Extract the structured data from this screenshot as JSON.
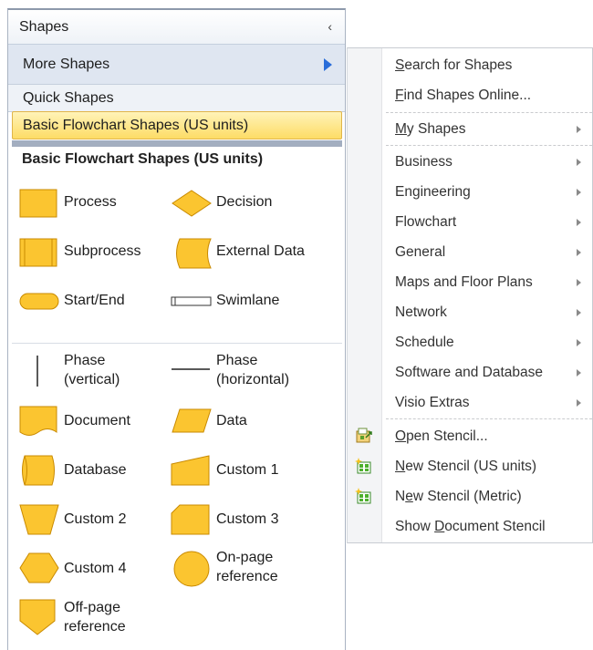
{
  "panel": {
    "title": "Shapes",
    "collapse_glyph": "‹",
    "more_shapes": "More Shapes",
    "quick_shapes": "Quick Shapes",
    "selected_stencil": "Basic Flowchart Shapes (US units)",
    "stencil_title": "Basic Flowchart Shapes (US units)",
    "shapes": [
      {
        "label": "Process",
        "icon": "process-icon"
      },
      {
        "label": "Decision",
        "icon": "decision-icon"
      },
      {
        "label": "Subprocess",
        "icon": "subprocess-icon"
      },
      {
        "label": "External Data",
        "icon": "external-data-icon"
      },
      {
        "label": "Start/End",
        "icon": "start-end-icon"
      },
      {
        "label": "Swimlane",
        "icon": "swimlane-icon"
      },
      {
        "label": "Phase\n(vertical)",
        "icon": "phase-vertical-icon"
      },
      {
        "label": "Phase\n(horizontal)",
        "icon": "phase-horizontal-icon"
      },
      {
        "label": "Document",
        "icon": "document-icon"
      },
      {
        "label": "Data",
        "icon": "data-icon"
      },
      {
        "label": "Database",
        "icon": "database-icon"
      },
      {
        "label": "Custom 1",
        "icon": "custom-1-icon"
      },
      {
        "label": "Custom 2",
        "icon": "custom-2-icon"
      },
      {
        "label": "Custom 3",
        "icon": "custom-3-icon"
      },
      {
        "label": "Custom 4",
        "icon": "custom-4-icon"
      },
      {
        "label": "On-page\nreference",
        "icon": "on-page-reference-icon"
      },
      {
        "label": "Off-page\nreference",
        "icon": "off-page-reference-icon"
      }
    ]
  },
  "menu": {
    "search_for_shapes": {
      "pre": "",
      "key": "S",
      "post": "earch for Shapes"
    },
    "find_shapes_online": {
      "pre": "",
      "key": "F",
      "post": "ind Shapes Online..."
    },
    "my_shapes": {
      "pre": "",
      "key": "M",
      "post": "y Shapes"
    },
    "categories": [
      "Business",
      "Engineering",
      "Flowchart",
      "General",
      "Maps and Floor Plans",
      "Network",
      "Schedule",
      "Software and Database",
      "Visio Extras"
    ],
    "open_stencil": {
      "pre": "",
      "key": "O",
      "post": "pen Stencil..."
    },
    "new_stencil_us": {
      "pre": "",
      "key": "N",
      "post": "ew Stencil (US units)"
    },
    "new_stencil_metric": {
      "pre": "N",
      "key": "e",
      "post": "w Stencil (Metric)"
    },
    "show_document_stencil": {
      "pre": "Show ",
      "key": "D",
      "post": "ocument Stencil"
    }
  },
  "colors": {
    "shape_fill": "#fbc530",
    "shape_stroke": "#c98a00",
    "selected_row": "#fddc66",
    "accent_arrow": "#2a6dd9"
  }
}
